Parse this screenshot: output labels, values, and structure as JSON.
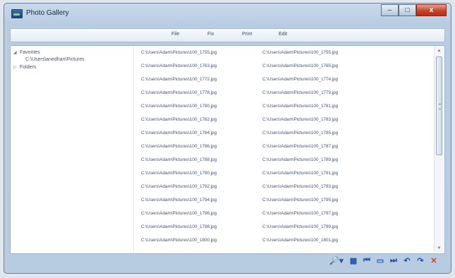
{
  "window": {
    "title": "Photo Gallery",
    "controls": {
      "minimize": "–",
      "maximize": "□",
      "close": "x"
    }
  },
  "menu": {
    "items": [
      "File",
      "Fix",
      "Print",
      "Edit"
    ]
  },
  "sidebar": {
    "favorites": "Favorites",
    "favorites_path": "C:\\Users\\anedhan\\Pictures",
    "folders": "Folders"
  },
  "files": [
    [
      "C:\\Users\\Adam\\Pictures\\100_1755.jpg",
      "C:\\Users\\Adam\\Pictures\\100_1755.jpg"
    ],
    [
      "C:\\Users\\Adam\\Pictures\\100_1763.jpg",
      "C:\\Users\\Adam\\Pictures\\100_1765.jpg"
    ],
    [
      "C:\\Users\\Adam\\Pictures\\100_1772.jpg",
      "C:\\Users\\Adam\\Pictures\\100_1774.jpg"
    ],
    [
      "C:\\Users\\Adam\\Pictures\\100_1778.jpg",
      "C:\\Users\\Adam\\Pictures\\100_1779.jpg"
    ],
    [
      "C:\\Users\\Adam\\Pictures\\100_1780.jpg",
      "C:\\Users\\Adam\\Pictures\\100_1781.jpg"
    ],
    [
      "C:\\Users\\Adam\\Pictures\\100_1782.jpg",
      "C:\\Users\\Adam\\Pictures\\100_1783.jpg"
    ],
    [
      "C:\\Users\\Adam\\Pictures\\100_1784.jpg",
      "C:\\Users\\Adam\\Pictures\\100_1785.jpg"
    ],
    [
      "C:\\Users\\Adam\\Pictures\\100_1786.jpg",
      "C:\\Users\\Adam\\Pictures\\100_1787.jpg"
    ],
    [
      "C:\\Users\\Adam\\Pictures\\100_1788.jpg",
      "C:\\Users\\Adam\\Pictures\\100_1789.jpg"
    ],
    [
      "C:\\Users\\Adam\\Pictures\\100_1790.jpg",
      "C:\\Users\\Adam\\Pictures\\100_1791.jpg"
    ],
    [
      "C:\\Users\\Adam\\Pictures\\100_1792.jpg",
      "C:\\Users\\Adam\\Pictures\\100_1793.jpg"
    ],
    [
      "C:\\Users\\Adam\\Pictures\\100_1794.jpg",
      "C:\\Users\\Adam\\Pictures\\100_1795.jpg"
    ],
    [
      "C:\\Users\\Adam\\Pictures\\100_1796.jpg",
      "C:\\Users\\Adam\\Pictures\\100_1797.jpg"
    ],
    [
      "C:\\Users\\Adam\\Pictures\\100_1798.jpg",
      "C:\\Users\\Adam\\Pictures\\100_1799.jpg"
    ],
    [
      "C:\\Users\\Adam\\Pictures\\100_1800.jpg",
      "C:\\Users\\Adam\\Pictures\\100_1801.jpg"
    ]
  ],
  "toolbar": [
    {
      "name": "search-zoom-icon",
      "glyph": "🔎▾",
      "wide": true
    },
    {
      "name": "slideshow-grid-icon",
      "glyph": "▦"
    },
    {
      "name": "previous-icon",
      "glyph": "⏮"
    },
    {
      "name": "slideshow-icon",
      "glyph": "▭"
    },
    {
      "name": "next-icon",
      "glyph": "⏭"
    },
    {
      "name": "rotate-counterclockwise-icon",
      "glyph": "↶"
    },
    {
      "name": "rotate-clockwise-icon",
      "glyph": "↷"
    },
    {
      "name": "delete-icon",
      "glyph": "✕",
      "danger": true
    }
  ]
}
